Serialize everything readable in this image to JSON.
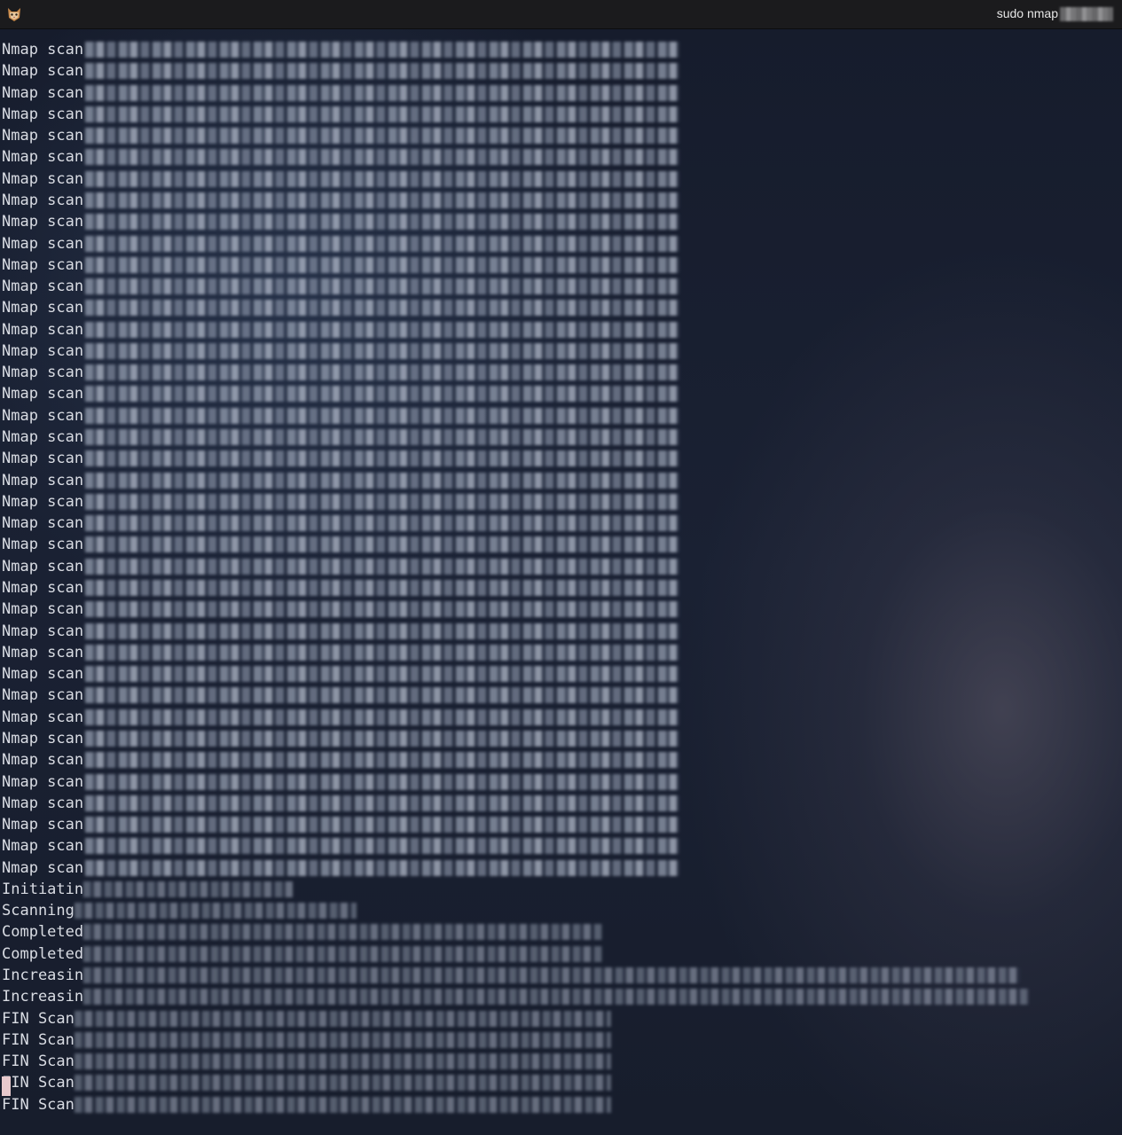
{
  "window": {
    "title": "sudo nmap"
  },
  "terminal": {
    "scan_report_prefix": "Nmap scan",
    "scan_report_count": 39,
    "tail": [
      {
        "prefix": "Initiatin",
        "blur_chars": 23
      },
      {
        "prefix": "Scanning",
        "blur_chars": 31
      },
      {
        "prefix": "Completed",
        "blur_chars": 57
      },
      {
        "prefix": "Completed",
        "blur_chars": 57
      },
      {
        "prefix": "Increasin",
        "blur_chars": 103
      },
      {
        "prefix": "Increasin",
        "blur_chars": 104
      },
      {
        "prefix": "FIN Scan",
        "blur_chars": 59
      },
      {
        "prefix": "FIN Scan",
        "blur_chars": 59
      },
      {
        "prefix": "FIN Scan",
        "blur_chars": 59
      },
      {
        "prefix": "FIN Scan",
        "blur_chars": 59
      },
      {
        "prefix": "FIN Scan",
        "blur_chars": 59
      }
    ]
  }
}
